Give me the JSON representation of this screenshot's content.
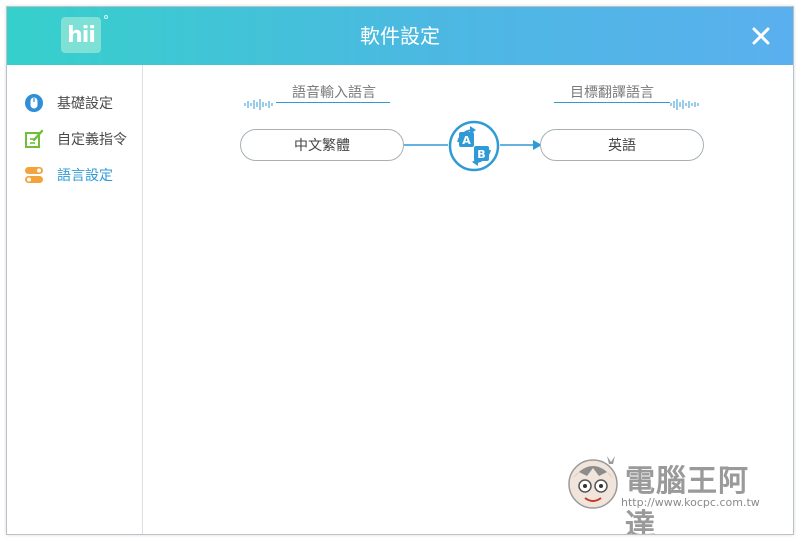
{
  "window": {
    "title": "軟件設定",
    "logo_text": "hii",
    "close_label": "close"
  },
  "sidebar": {
    "items": [
      {
        "label": "基礎設定",
        "icon": "mouse-icon",
        "active": false
      },
      {
        "label": "自定義指令",
        "icon": "edit-icon",
        "active": false
      },
      {
        "label": "語言設定",
        "icon": "language-switch-icon",
        "active": true
      }
    ]
  },
  "language": {
    "input_heading": "語音輸入語言",
    "input_value": "中文繁體",
    "output_heading": "目標翻譯語言",
    "output_value": "英語",
    "swap_icon_labels": [
      "A",
      "B"
    ]
  },
  "watermark": {
    "text": "電腦王阿達",
    "url": "http://www.kocpc.com.tw"
  },
  "colors": {
    "title_gradient_start": "#36d0cb",
    "title_gradient_end": "#5ab0ee",
    "accent": "#2f9ad6",
    "edit_icon": "#6fbf3a",
    "lang_icon": "#f2a33a"
  }
}
